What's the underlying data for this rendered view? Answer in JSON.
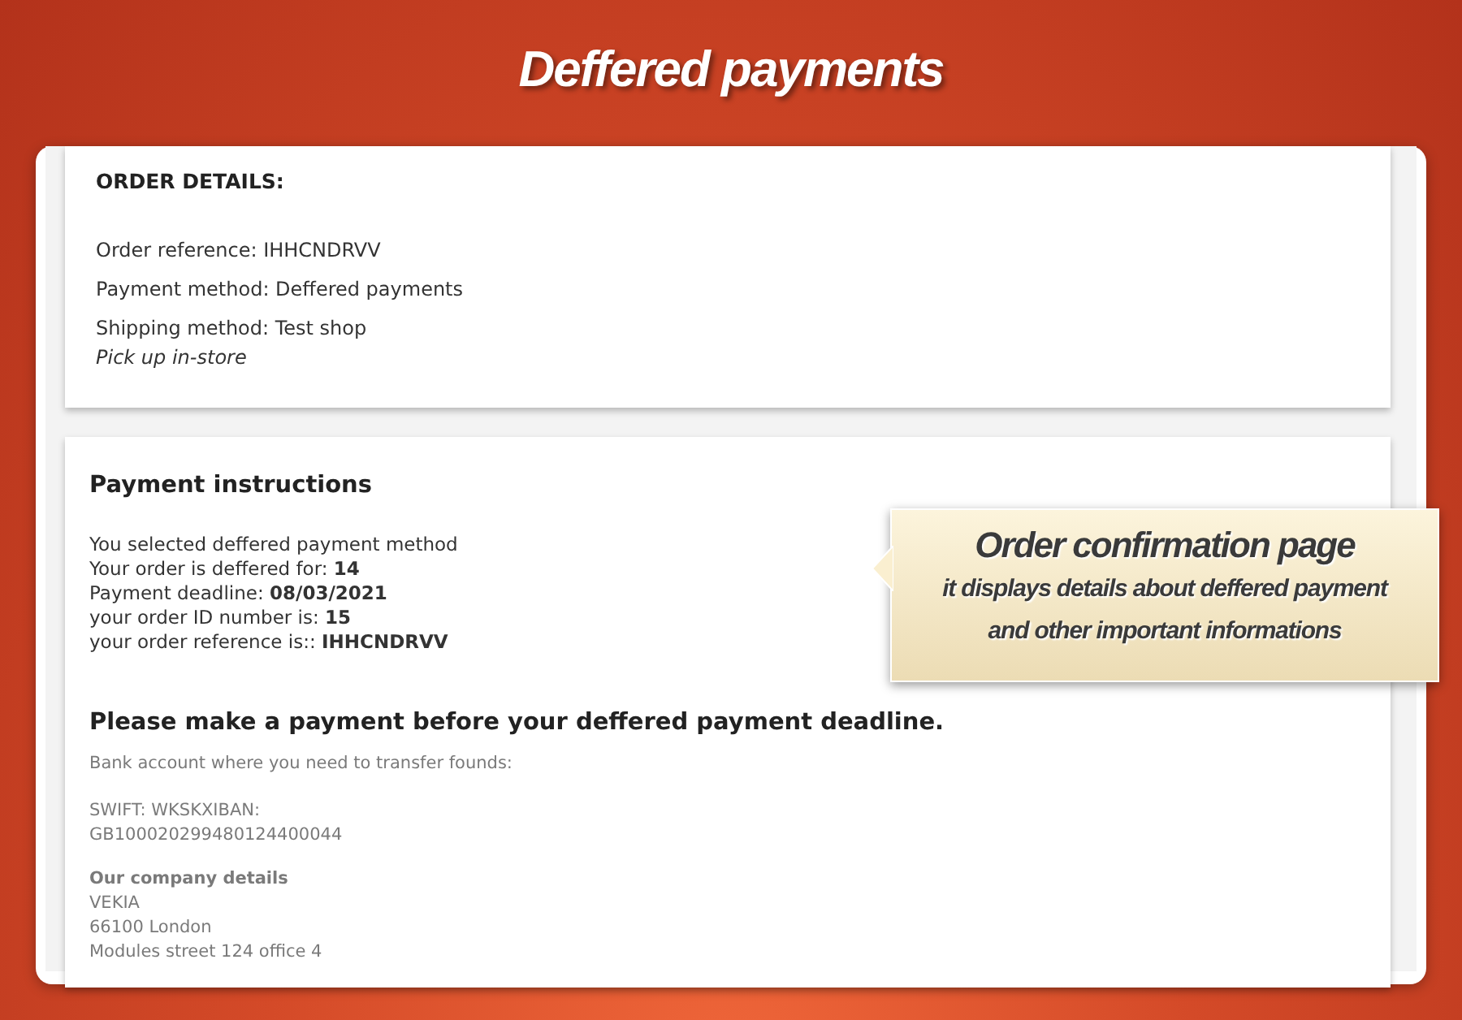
{
  "banner_title": "Deffered payments",
  "order_details": {
    "heading": "ORDER DETAILS:",
    "lines": [
      "Order reference: IHHCNDRVV",
      "Payment method: Deffered payments",
      "Shipping method: Test shop"
    ],
    "shipping_note": "Pick up in-store"
  },
  "payment_instructions": {
    "heading": "Payment instructions",
    "lines": [
      "You selected deffered payment method",
      "Your order is deffered for: **14**",
      "Payment deadline: **08/03/2021**",
      "your order ID number is: **15**",
      "your order reference is:: **IHHCNDRVV**"
    ],
    "notice": "Please make a payment before your deffered payment deadline.",
    "bank_intro": "Bank account where you need to transfer founds:",
    "bank_lines": [
      "SWIFT: WKSKXIBAN:",
      "GB100020299480124400044"
    ],
    "company_heading": "Our company details",
    "company_lines": [
      "VEKIA",
      "66100 London",
      "Modules street 124 office 4"
    ]
  },
  "callout": {
    "title": "Order confirmation page",
    "lines": [
      "it displays details about deffered payment",
      "and other important informations"
    ]
  }
}
